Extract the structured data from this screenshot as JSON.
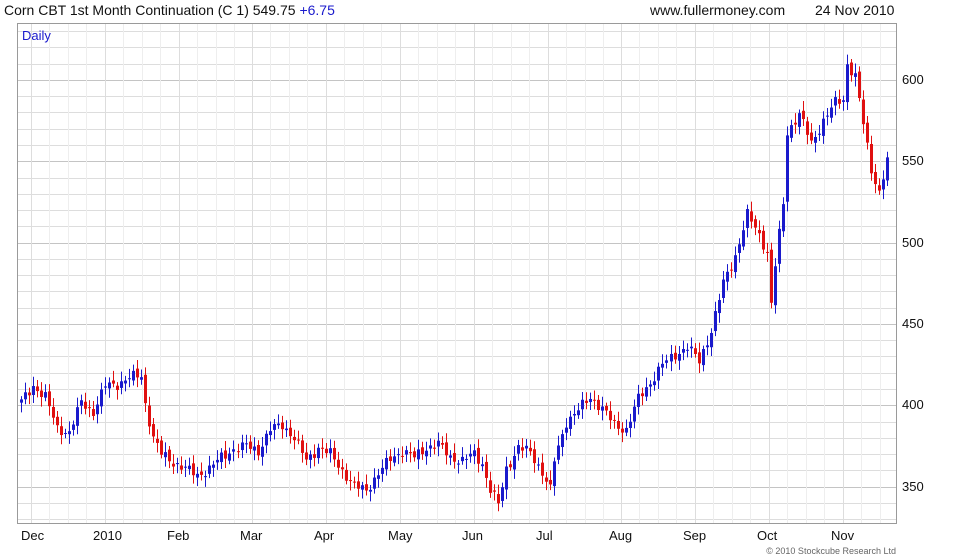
{
  "header": {
    "title": "Corn CBT 1st Month Continuation (C 1) 549.75",
    "change": "+6.75",
    "website": "www.fullermoney.com",
    "date": "24 Nov 2010"
  },
  "panel_label": "Daily",
  "footer": "© 2010 Stockcube Research Ltd",
  "colors": {
    "up": "#1a1acc",
    "down": "#e01010",
    "grid": "#dddddd"
  },
  "chart_data": {
    "type": "ohlc",
    "x_tick_labels": [
      "Dec",
      "2010",
      "Feb",
      "Mar",
      "Apr",
      "May",
      "Jun",
      "Jul",
      "Aug",
      "Sep",
      "Oct",
      "Nov"
    ],
    "y_tick_labels": [
      "350",
      "400",
      "450",
      "500",
      "550",
      "600"
    ],
    "ylim": [
      327,
      635
    ],
    "y_ticks": [
      350,
      400,
      450,
      500,
      550,
      600
    ],
    "y_minor_step": 10,
    "grid": true,
    "anchors": [
      {
        "t": 0,
        "v": 402
      },
      {
        "t": 3,
        "v": 412
      },
      {
        "t": 6,
        "v": 405
      },
      {
        "t": 9,
        "v": 386
      },
      {
        "t": 12,
        "v": 383
      },
      {
        "t": 15,
        "v": 402
      },
      {
        "t": 18,
        "v": 396
      },
      {
        "t": 21,
        "v": 412
      },
      {
        "t": 24,
        "v": 413
      },
      {
        "t": 27,
        "v": 417
      },
      {
        "t": 30,
        "v": 418
      },
      {
        "t": 31,
        "v": 401
      },
      {
        "t": 33,
        "v": 380
      },
      {
        "t": 35,
        "v": 370
      },
      {
        "t": 38,
        "v": 365
      },
      {
        "t": 41,
        "v": 361
      },
      {
        "t": 44,
        "v": 357
      },
      {
        "t": 47,
        "v": 361
      },
      {
        "t": 50,
        "v": 368
      },
      {
        "t": 53,
        "v": 373
      },
      {
        "t": 56,
        "v": 375
      },
      {
        "t": 59,
        "v": 372
      },
      {
        "t": 62,
        "v": 385
      },
      {
        "t": 65,
        "v": 388
      },
      {
        "t": 68,
        "v": 380
      },
      {
        "t": 71,
        "v": 366
      },
      {
        "t": 74,
        "v": 374
      },
      {
        "t": 77,
        "v": 370
      },
      {
        "t": 80,
        "v": 360
      },
      {
        "t": 83,
        "v": 350
      },
      {
        "t": 86,
        "v": 348
      },
      {
        "t": 89,
        "v": 358
      },
      {
        "t": 92,
        "v": 367
      },
      {
        "t": 95,
        "v": 372
      },
      {
        "t": 98,
        "v": 368
      },
      {
        "t": 101,
        "v": 374
      },
      {
        "t": 104,
        "v": 376
      },
      {
        "t": 107,
        "v": 368
      },
      {
        "t": 110,
        "v": 366
      },
      {
        "t": 113,
        "v": 370
      },
      {
        "t": 115,
        "v": 364
      },
      {
        "t": 117,
        "v": 348
      },
      {
        "t": 119,
        "v": 339
      },
      {
        "t": 121,
        "v": 361
      },
      {
        "t": 124,
        "v": 374
      },
      {
        "t": 127,
        "v": 371
      },
      {
        "t": 130,
        "v": 359
      },
      {
        "t": 132,
        "v": 348
      },
      {
        "t": 133,
        "v": 366
      },
      {
        "t": 136,
        "v": 390
      },
      {
        "t": 139,
        "v": 397
      },
      {
        "t": 142,
        "v": 405
      },
      {
        "t": 145,
        "v": 398
      },
      {
        "t": 148,
        "v": 388
      },
      {
        "t": 151,
        "v": 385
      },
      {
        "t": 154,
        "v": 404
      },
      {
        "t": 157,
        "v": 414
      },
      {
        "t": 160,
        "v": 425
      },
      {
        "t": 163,
        "v": 431
      },
      {
        "t": 166,
        "v": 436
      },
      {
        "t": 169,
        "v": 427
      },
      {
        "t": 172,
        "v": 446
      },
      {
        "t": 175,
        "v": 475
      },
      {
        "t": 178,
        "v": 492
      },
      {
        "t": 181,
        "v": 517
      },
      {
        "t": 184,
        "v": 505
      },
      {
        "t": 186,
        "v": 494
      },
      {
        "t": 187,
        "v": 462
      },
      {
        "t": 188,
        "v": 486
      },
      {
        "t": 190,
        "v": 524
      },
      {
        "t": 191,
        "v": 568
      },
      {
        "t": 194,
        "v": 579
      },
      {
        "t": 197,
        "v": 561
      },
      {
        "t": 200,
        "v": 575
      },
      {
        "t": 203,
        "v": 586
      },
      {
        "t": 205,
        "v": 588
      },
      {
        "t": 206,
        "v": 610
      },
      {
        "t": 208,
        "v": 602
      },
      {
        "t": 210,
        "v": 573
      },
      {
        "t": 212,
        "v": 545
      },
      {
        "t": 214,
        "v": 531
      },
      {
        "t": 216,
        "v": 550
      }
    ]
  }
}
